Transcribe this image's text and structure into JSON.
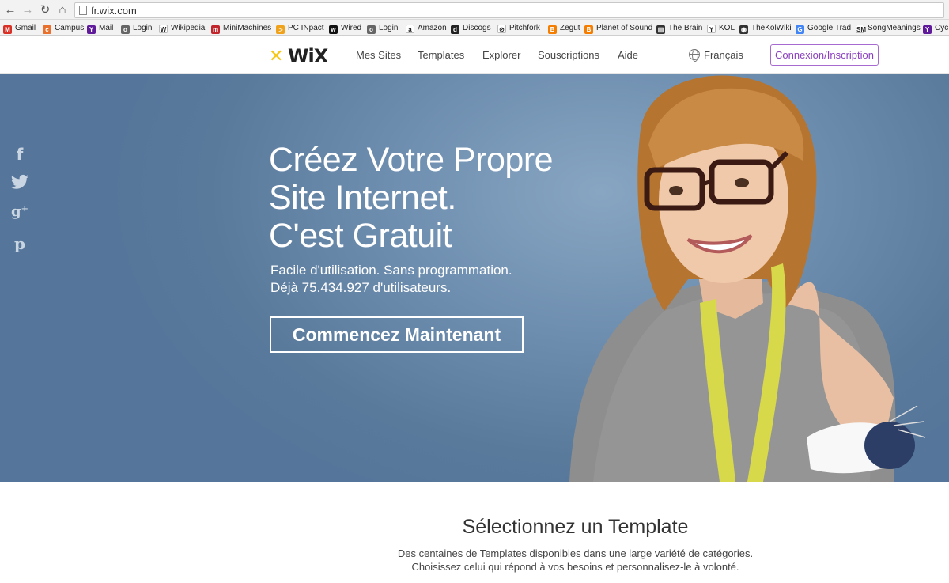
{
  "browser": {
    "url": "fr.wix.com",
    "bookmarks": [
      {
        "label": "Gmail",
        "icon": "gmail-icon",
        "color": "#d93025",
        "glyph": "M"
      },
      {
        "label": "Campus",
        "icon": "campus-icon",
        "color": "#e8712d",
        "glyph": "c"
      },
      {
        "label": "Mail",
        "icon": "yahoo-icon",
        "color": "#5f1b9a",
        "glyph": "Y"
      },
      {
        "label": "Login",
        "icon": "login-icon",
        "color": "#666666",
        "glyph": "o"
      },
      {
        "label": "Wikipedia",
        "icon": "wikipedia-icon",
        "color": "#ffffff",
        "glyph": "W"
      },
      {
        "label": "MiniMachines",
        "icon": "minimachines-icon",
        "color": "#c0262c",
        "glyph": "m"
      },
      {
        "label": "PC INpact",
        "icon": "pcinpact-icon",
        "color": "#f0a21a",
        "glyph": "▷"
      },
      {
        "label": "Wired",
        "icon": "wired-icon",
        "color": "#111111",
        "glyph": "w"
      },
      {
        "label": "Login",
        "icon": "login-icon",
        "color": "#666666",
        "glyph": "o"
      },
      {
        "label": "Amazon",
        "icon": "amazon-icon",
        "color": "#ffffff",
        "glyph": "a"
      },
      {
        "label": "Discogs",
        "icon": "discogs-icon",
        "color": "#222222",
        "glyph": "d"
      },
      {
        "label": "Pitchfork",
        "icon": "pitchfork-icon",
        "color": "#ffffff",
        "glyph": "⊘"
      },
      {
        "label": "Zegut",
        "icon": "blogger-icon",
        "color": "#f57d00",
        "glyph": "B"
      },
      {
        "label": "Planet of Sound",
        "icon": "blogger-icon",
        "color": "#f57d00",
        "glyph": "B"
      },
      {
        "label": "The Brain",
        "icon": "brain-icon",
        "color": "#333333",
        "glyph": "▥"
      },
      {
        "label": "KOL",
        "icon": "kol-icon",
        "color": "#ffffff",
        "glyph": "Y"
      },
      {
        "label": "TheKolWiki",
        "icon": "kolwiki-icon",
        "color": "#333333",
        "glyph": "◉"
      },
      {
        "label": "Google Trad",
        "icon": "google-translate-icon",
        "color": "#4285f4",
        "glyph": "G"
      },
      {
        "label": "SongMeanings",
        "icon": "songmeanings-icon",
        "color": "#ffffff",
        "glyph": "SM"
      },
      {
        "label": "Cyc",
        "icon": "yahoo-icon",
        "color": "#5f1b9a",
        "glyph": "Y"
      }
    ]
  },
  "header": {
    "logo": "WiX",
    "nav": [
      "Mes Sites",
      "Templates",
      "Explorer",
      "Souscriptions",
      "Aide"
    ],
    "language": "Français",
    "login": "Connexion/Inscription",
    "login_color": "#8a3fbf"
  },
  "social": [
    "facebook-icon",
    "twitter-icon",
    "google-plus-icon",
    "pinterest-icon"
  ],
  "hero": {
    "title_lines": [
      "Créez Votre Propre",
      "Site Internet.",
      "C'est Gratuit"
    ],
    "subtitle_lines": [
      "Facile d'utilisation. Sans programmation.",
      "Déjà 75.434.927 d'utilisateurs."
    ],
    "cta": "Commencez Maintenant",
    "background": "#6d8daf"
  },
  "templates_section": {
    "title": "Sélectionnez un Template",
    "description_lines": [
      "Des centaines de Templates disponibles dans une large variété de catégories.",
      "Choisissez celui qui répond à vos besoins et personnalisez-le à volonté."
    ]
  }
}
